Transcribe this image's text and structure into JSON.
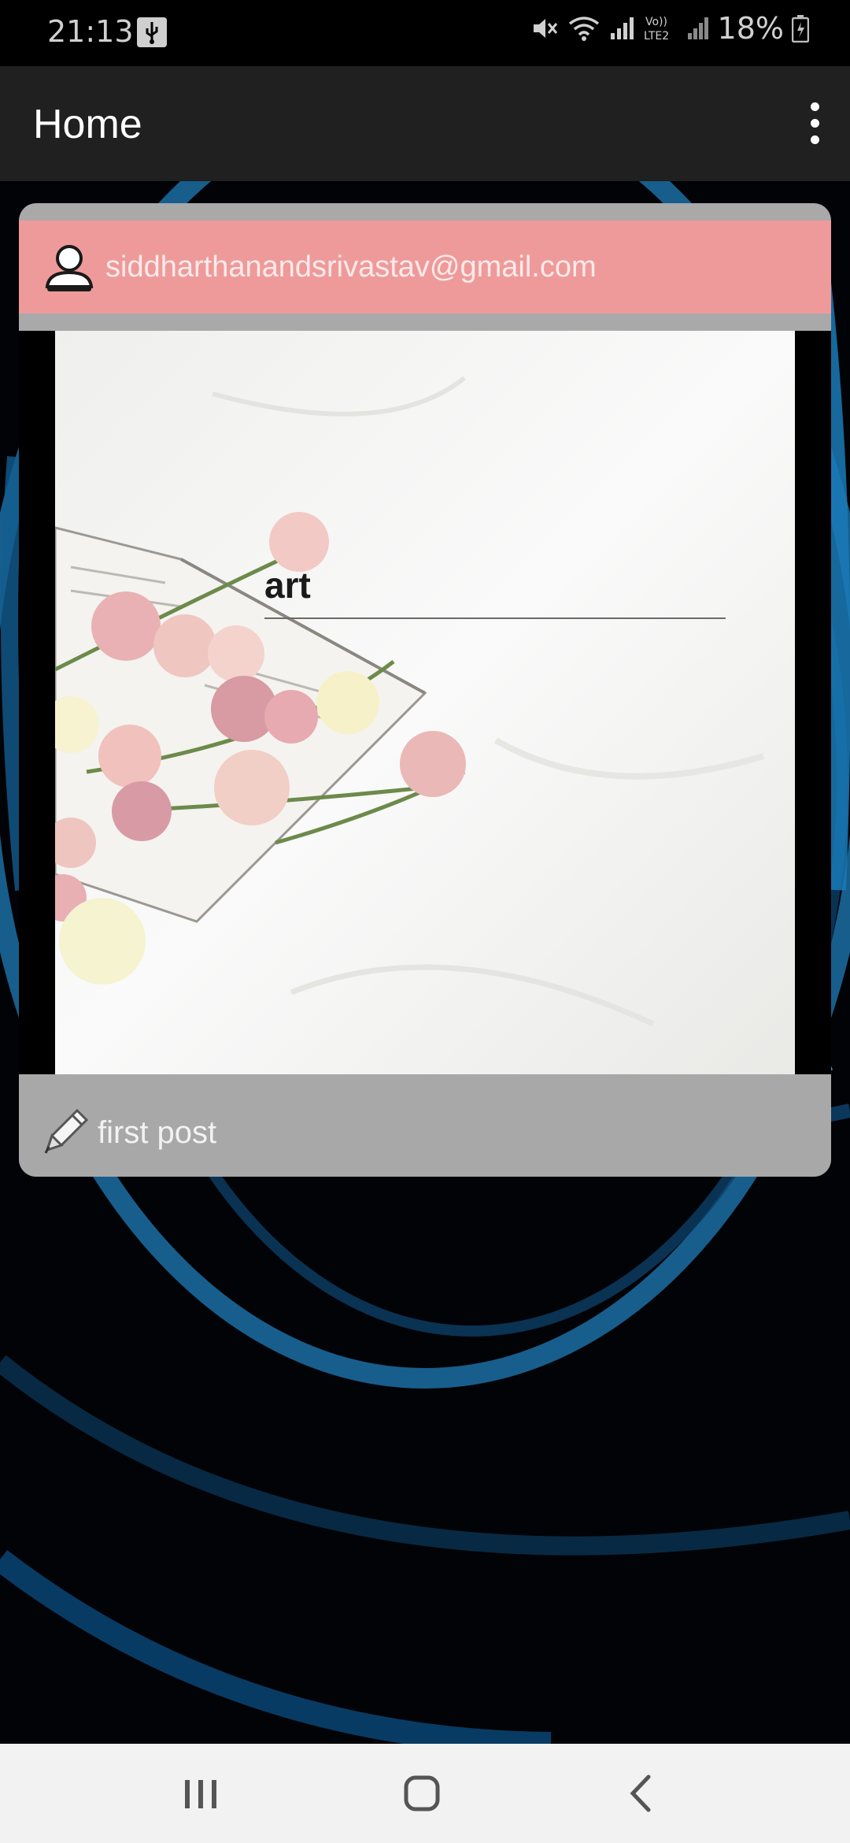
{
  "status_bar": {
    "time": "21:13",
    "battery": "18%",
    "icons": [
      "usb-icon",
      "mute-icon",
      "wifi-icon",
      "signal-icon",
      "volte-icon",
      "battery-icon"
    ],
    "network_label": "Vo)) LTE2"
  },
  "app_bar": {
    "title": "Home",
    "menu_icon": "more-vert-icon"
  },
  "post": {
    "user_email": "siddharthanandsrivastav@gmail.com",
    "user_icon": "person-icon",
    "image_title": "art",
    "caption": "first post",
    "caption_icon": "pencil-icon"
  },
  "colors": {
    "header_bg": "#ef9a9a",
    "card_bg": "#a9a9a9",
    "app_bar_bg": "#202020",
    "nav_bar_bg": "#f2f2f2",
    "swirl_blue": "#1e88c8"
  },
  "nav_bar": {
    "buttons": [
      "recent-apps-icon",
      "home-icon",
      "back-icon"
    ]
  }
}
